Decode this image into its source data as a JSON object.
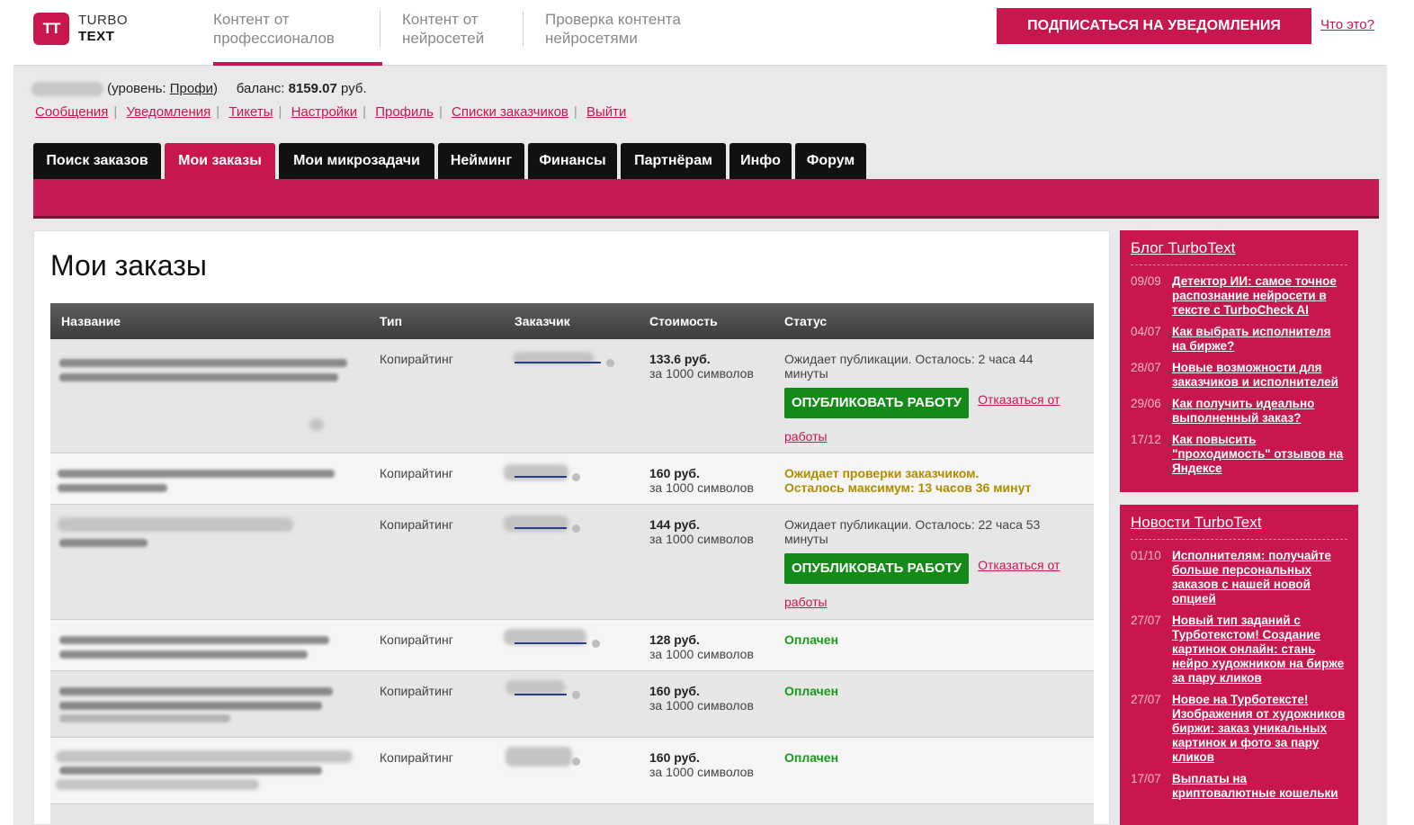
{
  "header": {
    "logo_mark": "TT",
    "logo_line1": "TURBO",
    "logo_line2": "TEXT",
    "nav": [
      {
        "line1": "Контент от",
        "line2": "профессионалов"
      },
      {
        "line1": "Контент от",
        "line2": "нейросетей"
      },
      {
        "line1": "Проверка контента",
        "line2": "нейросетями"
      }
    ],
    "subscribe_label": "ПОДПИСАТЬСЯ НА УВЕДОМЛЕНИЯ",
    "what_label": "Что это?"
  },
  "user": {
    "level_prefix": "(уровень: ",
    "level": "Профи",
    "level_suffix": ")",
    "balance_label": "баланс:",
    "balance_value": "8159.07",
    "balance_currency": "руб."
  },
  "links": [
    "Сообщения",
    "Уведомления",
    "Тикеты",
    "Настройки",
    "Профиль",
    "Списки заказчиков",
    "Выйти"
  ],
  "tabs": [
    "Поиск заказов",
    "Мои заказы",
    "Мои микрозадачи",
    "Нейминг",
    "Финансы",
    "Партнёрам",
    "Инфо",
    "Форум"
  ],
  "main": {
    "title": "Мои заказы",
    "columns": [
      "Название",
      "Тип",
      "Заказчик",
      "Стоимость",
      "Статус"
    ],
    "publish_label": "ОПУБЛИКОВАТЬ РАБОТУ",
    "refuse_label_1": "Отказаться от",
    "refuse_label_2": "работы",
    "per_label": "за 1000 символов",
    "orders": [
      {
        "type": "Копирайтинг",
        "price": "133.6 руб.",
        "status": "Ожидает публикации. Осталось: 2 часа 44 минуты"
      },
      {
        "type": "Копирайтинг",
        "price": "160 руб.",
        "status_line1": "Ожидает проверки заказчиком.",
        "status_line2": "Осталось максимум: 13 часов 36 минут"
      },
      {
        "type": "Копирайтинг",
        "price": "144 руб.",
        "status": "Ожидает публикации. Осталось: 22 часа 53 минуты"
      },
      {
        "type": "Копирайтинг",
        "price": "128 руб.",
        "status": "Оплачен"
      },
      {
        "type": "Копирайтинг",
        "price": "160 руб.",
        "status": "Оплачен"
      },
      {
        "type": "Копирайтинг",
        "price": "160 руб.",
        "status": "Оплачен"
      }
    ]
  },
  "sidebar": {
    "blog_title": "Блог TurboText",
    "blog": [
      {
        "date": "09/09",
        "title": "Детектор ИИ: самое точное распознание нейросети в тексте с TurboCheck AI"
      },
      {
        "date": "04/07",
        "title": "Как выбрать исполнителя на бирже?"
      },
      {
        "date": "28/07",
        "title": "Новые возможности для заказчиков и исполнителей"
      },
      {
        "date": "29/06",
        "title": "Как получить идеально выполненный заказ?"
      },
      {
        "date": "17/12",
        "title": "Как повысить \"проходимость\" отзывов на Яндексе"
      }
    ],
    "news_title": "Новости TurboText",
    "news": [
      {
        "date": "01/10",
        "title": "Исполнителям: получайте больше персональных заказов с нашей новой опцией"
      },
      {
        "date": "27/07",
        "title": "Новый тип заданий с Турботекстом! Создание картинок онлайн: стань нейро художником на бирже за пару кликов"
      },
      {
        "date": "27/07",
        "title": "Новое на Турботексте! Изображения от художников биржи: заказ уникальных картинок и фото за пару кликов"
      },
      {
        "date": "17/07",
        "title": "Выплаты на криптовалютные кошельки"
      }
    ]
  }
}
